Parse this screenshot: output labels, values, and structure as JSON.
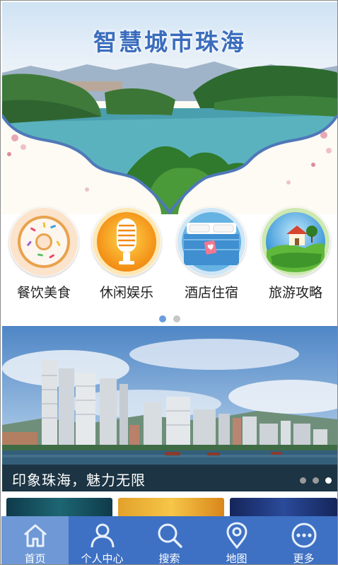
{
  "banner": {
    "title": "智慧城市珠海"
  },
  "categories": [
    {
      "label": "餐饮美食",
      "icon": "donut-icon"
    },
    {
      "label": "休闲娱乐",
      "icon": "microphone-icon"
    },
    {
      "label": "酒店住宿",
      "icon": "hotel-bed-icon"
    },
    {
      "label": "旅游攻略",
      "icon": "travel-house-icon"
    }
  ],
  "category_pager": {
    "pages": 2,
    "active": 1
  },
  "city_banner": {
    "caption": "印象珠海，魅力无限",
    "slides": 3,
    "active": 3
  },
  "nav": {
    "items": [
      {
        "label": "首页",
        "icon": "home-icon"
      },
      {
        "label": "个人中心",
        "icon": "user-icon"
      },
      {
        "label": "搜索",
        "icon": "search-icon"
      },
      {
        "label": "地图",
        "icon": "map-pin-icon"
      },
      {
        "label": "更多",
        "icon": "more-icon"
      }
    ],
    "active": 0
  },
  "colors": {
    "nav_bg": "#3e71c4",
    "nav_active": "#6e98d6",
    "title": "#3b6dbd",
    "dot_active": "#6d9de0"
  }
}
